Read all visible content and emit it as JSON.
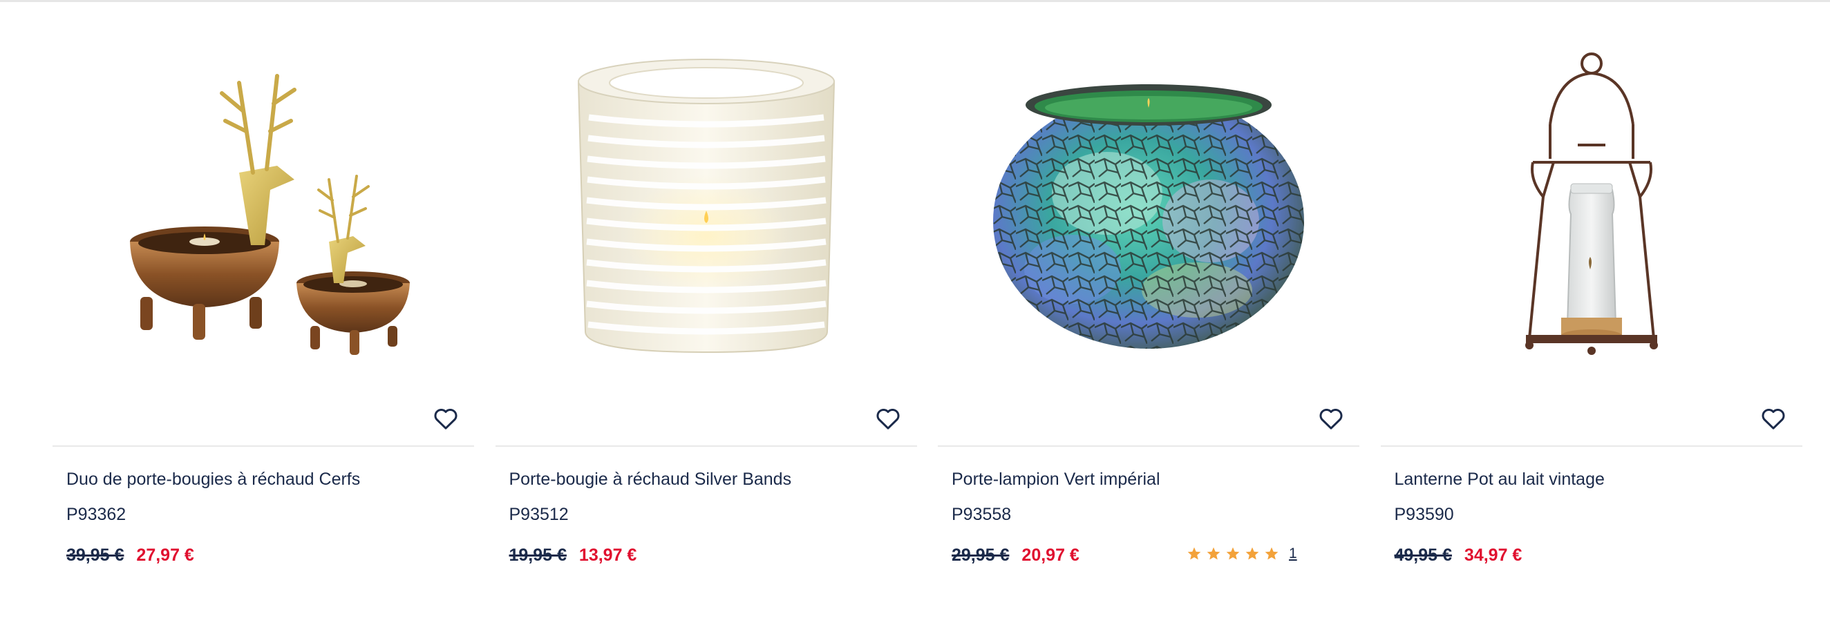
{
  "colors": {
    "navy": "#1b2a4a",
    "sale_red": "#e0102f",
    "star_orange": "#f3a23a",
    "divider": "#e9e9e9"
  },
  "icons": {
    "favorite": "heart-outline-icon",
    "rating": "star-icon"
  },
  "products": [
    {
      "title": "Duo de porte-bougies à réchaud Cerfs",
      "ref": "P93362",
      "old_price": "39,95 €",
      "new_price": "27,97 €"
    },
    {
      "title": "Porte-bougie à réchaud Silver Bands",
      "ref": "P93512",
      "old_price": "19,95 €",
      "new_price": "13,97 €"
    },
    {
      "title": "Porte-lampion Vert impérial",
      "ref": "P93558",
      "old_price": "29,95 €",
      "new_price": "20,97 €",
      "rating_stars": 5,
      "review_count": "1"
    },
    {
      "title": "Lanterne Pot au lait vintage",
      "ref": "P93590",
      "old_price": "49,95 €",
      "new_price": "34,97 €"
    }
  ]
}
